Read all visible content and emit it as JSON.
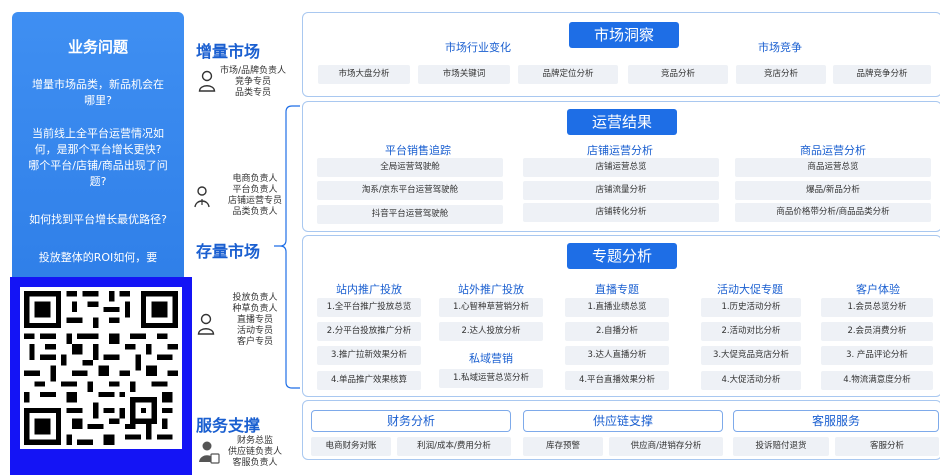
{
  "left_panel": {
    "title": "业务问题",
    "questions": [
      "增量市场品类，新品机会在哪里?",
      "当前线上全平台运营情况如何，是那个平台增长更快? 哪个平台/店铺/商品出现了问题?",
      "如何找到平台增长最优路径?",
      "投放整体的ROI如何，要"
    ]
  },
  "categories": {
    "incremental": {
      "label": "增量市场",
      "roles": [
        "市场/品牌负责人",
        "竞争专员",
        "品类专员"
      ]
    },
    "ops_roles": [
      "电商负责人",
      "平台负责人",
      "店铺运营专员",
      "品类负责人"
    ],
    "existing": {
      "label": "存量市场",
      "roles": [
        "投放负责人",
        "种草负责人",
        "直播专员",
        "活动专员",
        "客户专员"
      ]
    },
    "service": {
      "label": "服务支撑",
      "roles": [
        "财务总监",
        "供应链负责人",
        "客服负责人"
      ]
    }
  },
  "market_insight": {
    "title": "市场洞察",
    "groups": [
      "市场行业变化",
      "市场竞争"
    ],
    "items": [
      "市场大盘分析",
      "市场关键词",
      "品牌定位分析",
      "竞品分析",
      "竞店分析",
      "品牌竞争分析"
    ]
  },
  "ops_results": {
    "title": "运营结果",
    "columns": [
      {
        "name": "平台销售追踪",
        "items": [
          "全局运营驾驶舱",
          "淘系/京东平台运营驾驶舱",
          "抖音平台运营驾驶舱"
        ]
      },
      {
        "name": "店铺运营分析",
        "items": [
          "店铺运营总览",
          "店铺流量分析",
          "店铺转化分析"
        ]
      },
      {
        "name": "商品运营分析",
        "items": [
          "商品运营总览",
          "爆品/新品分析",
          "商品价格带分析/商品品类分析"
        ]
      }
    ]
  },
  "special_analysis": {
    "title": "专题分析",
    "columns": [
      {
        "name": "站内推广投放",
        "items": [
          "1.全平台推广投放总览",
          "2.分平台投放推广分析",
          "3.推广拉新效果分析",
          "4.单品推广效果核算"
        ]
      },
      {
        "name": "站外推广投放",
        "items": [
          "1.心智种草营销分析",
          "2.达人投放分析"
        ]
      },
      {
        "name": "私域营销",
        "items": [
          "1.私域运营总览分析"
        ]
      },
      {
        "name": "直播专题",
        "items": [
          "1.直播业绩总览",
          "2.自播分析",
          "3.达人直播分析",
          "4.平台直播效果分析"
        ]
      },
      {
        "name": "活动大促专题",
        "items": [
          "1.历史活动分析",
          "2.活动对比分析",
          "3.大促竞品竞店分析",
          "4.大促活动分析"
        ]
      },
      {
        "name": "客户体验",
        "items": [
          "1.会员总览分析",
          "2.会员消费分析",
          "3. 产品评论分析",
          "4.物流满意度分析"
        ]
      }
    ]
  },
  "service_support": {
    "groups": [
      "财务分析",
      "供应链支撑",
      "客服服务"
    ],
    "items": [
      "电商财务对账",
      "利润/成本/费用分析",
      "库存预警",
      "供应商/进销存分析",
      "投诉赔付退货",
      "客服分析"
    ]
  },
  "colors": {
    "accent": "#1e6ee6",
    "panel": "#3f8ff2",
    "border": "#a9c8f0",
    "pill": "#eef1f6",
    "qr_frame": "#1414f5"
  }
}
